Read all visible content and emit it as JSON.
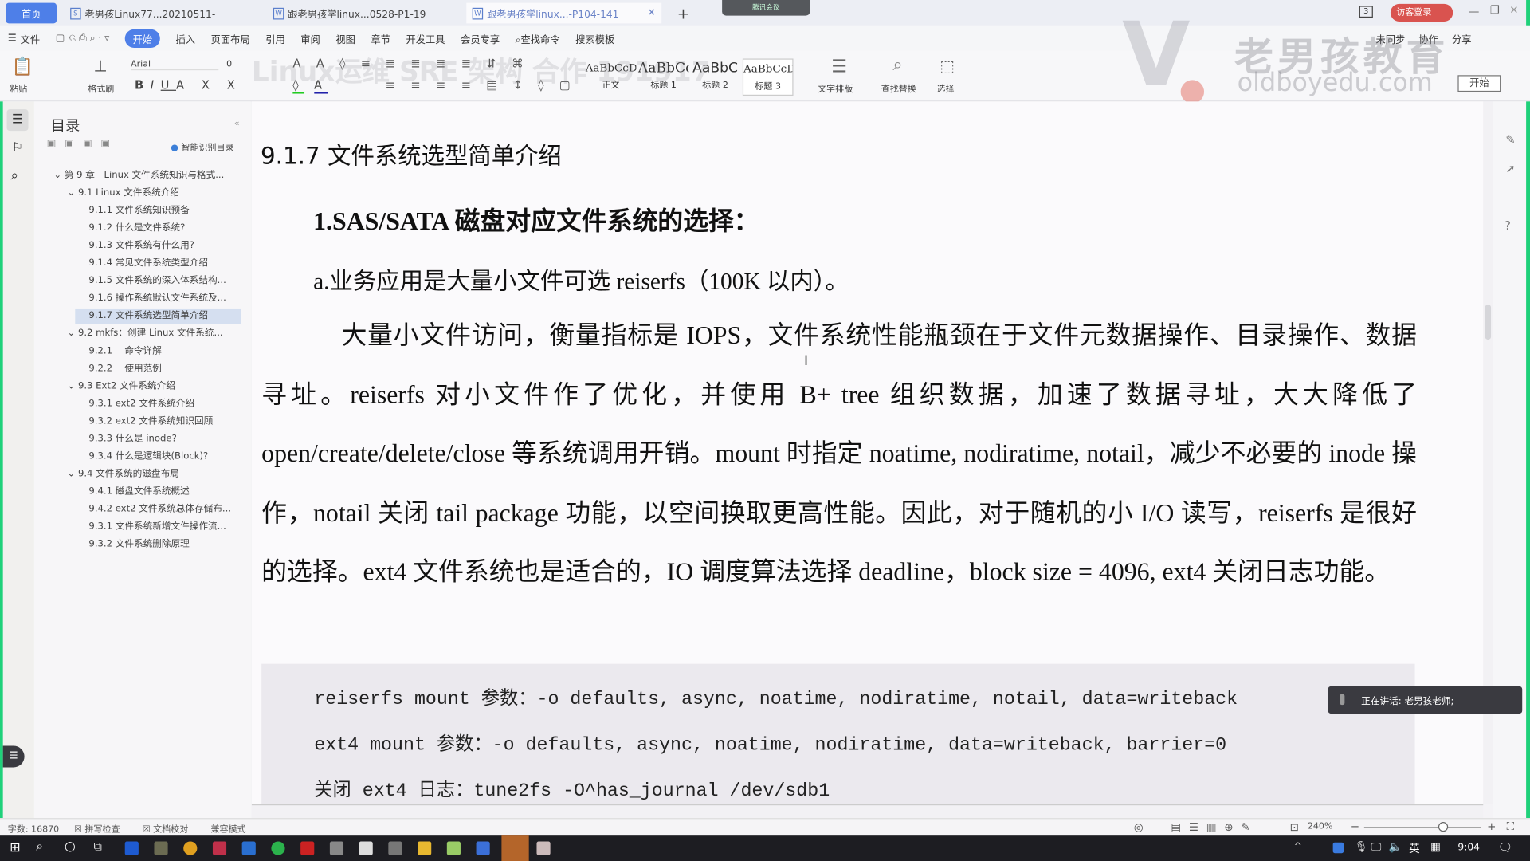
{
  "tabs": {
    "home": "首页",
    "items": [
      {
        "label": "老男孩Linux77...20210511-"
      },
      {
        "label": "跟老男孩学linux...0528-P1-19"
      },
      {
        "label": "跟老男孩学linux...-P104-141"
      }
    ],
    "new_tab": "+",
    "meeting_badge": "腾讯会议"
  },
  "window": {
    "page_count": "3",
    "login": "访客登录"
  },
  "menu": {
    "file": "文件",
    "items": [
      "开始",
      "插入",
      "页面布局",
      "引用",
      "审阅",
      "视图",
      "章节",
      "开发工具",
      "会员专享"
    ],
    "search_cmd": "查找命令",
    "search_template": "搜索模板",
    "right": [
      "未同步",
      "协作",
      "分享"
    ]
  },
  "ribbon": {
    "paste": "粘贴",
    "format_painter": "格式刷",
    "font_name": "Arial",
    "font_size": "0",
    "styles": [
      {
        "sample": "AaBbCcDd",
        "label": "正文"
      },
      {
        "sample": "AaBbCc",
        "label": "标题 1"
      },
      {
        "sample": "AaBbC",
        "label": "标题 2"
      },
      {
        "sample": "AaBbCcDd",
        "label": "标题 3"
      }
    ],
    "text_layout": "文字排版",
    "find_replace": "查找替换",
    "select": "选择",
    "start_button": "开始"
  },
  "sidebar": {
    "title": "目录",
    "smart_toc": "智能识别目录",
    "items": [
      {
        "label": "第 9 章　Linux 文件系统知识与格式...",
        "level": 0
      },
      {
        "label": "9.1 Linux 文件系统介绍",
        "level": 1
      },
      {
        "label": "9.1.1 文件系统知识预备",
        "level": 2
      },
      {
        "label": "9.1.2 什么是文件系统?",
        "level": 2
      },
      {
        "label": "9.1.3 文件系统有什么用?",
        "level": 2
      },
      {
        "label": "9.1.4  常见文件系统类型介绍",
        "level": 2
      },
      {
        "label": "9.1.5 文件系统的深入体系结构...",
        "level": 2
      },
      {
        "label": "9.1.6 操作系统默认文件系统及...",
        "level": 2
      },
      {
        "label": "9.1.7 文件系统选型简单介绍",
        "level": 2,
        "selected": true
      },
      {
        "label": "9.2 mkfs：创建 Linux 文件系统...",
        "level": 1
      },
      {
        "label": "9.2.1　 命令详解",
        "level": 2
      },
      {
        "label": "9.2.2　 使用范例",
        "level": 2
      },
      {
        "label": "9.3 Ext2 文件系统介绍",
        "level": 1
      },
      {
        "label": "9.3.1 ext2 文件系统介绍",
        "level": 2
      },
      {
        "label": "9.3.2 ext2 文件系统知识回顾",
        "level": 2
      },
      {
        "label": "9.3.3 什么是 inode?",
        "level": 2
      },
      {
        "label": "9.3.4 什么是逻辑块(Block)?",
        "level": 2
      },
      {
        "label": "9.4 文件系统的磁盘布局",
        "level": 1
      },
      {
        "label": "9.4.1 磁盘文件系统概述",
        "level": 2
      },
      {
        "label": "9.4.2 ext2 文件系统总体存储布...",
        "level": 2
      },
      {
        "label": "9.3.1 文件系统新增文件操作流...",
        "level": 2
      },
      {
        "label": "9.3.2 文件系统删除原理",
        "level": 2
      }
    ]
  },
  "document": {
    "heading": "9.1.7 文件系统选型简单介绍",
    "subheading": "1.SAS/SATA 磁盘对应文件系统的选择：",
    "point_a": "a.业务应用是大量小文件可选 reiserfs（100K 以内）。",
    "paragraph": "大量小文件访问，衡量指标是 IOPS，文件系统性能瓶颈在于文件元数据操作、目录操作、数据寻址。reiserfs 对小文件作了优化，并使用 B+ tree 组织数据，加速了数据寻址，大大降低了 open/create/delete/close 等系统调用开销。mount 时指定 noatime, nodiratime, notail，减少不必要的 inode 操作，notail 关闭 tail package 功能，以空间换取更高性能。因此，对于随机的小 I/O 读写，reiserfs 是很好的选择。ext4 文件系统也是适合的，IO 调度算法选择 deadline，block size = 4096, ext4 关闭日志功能。",
    "code": [
      "reiserfs mount 参数：-o defaults, async, noatime, nodiratime, notail, data=writeback",
      "ext4 mount 参数：-o defaults, async, noatime, nodiratime, data=writeback, barrier=0",
      "关闭 ext4 日志：tune2fs -O^has_journal /dev/sdb1"
    ]
  },
  "watermark": {
    "brand": "老男孩教育",
    "url": "oldboyedu.com",
    "overlay": "Linux运维 SRE 架构 合作 微信 191917"
  },
  "toast": "正在讲话: 老男孩老师;",
  "status": {
    "word_count": "字数: 16870",
    "spell_check": "拼写检查",
    "doc_proof": "文档校对",
    "compat_mode": "兼容模式",
    "zoom": "240%",
    "zoom_level": 240
  },
  "taskbar": {
    "time": "9:04",
    "ime": "英"
  },
  "colors": {
    "accent": "#4e7fe8",
    "green_border": "#1fd17a",
    "login": "#d9534f"
  }
}
